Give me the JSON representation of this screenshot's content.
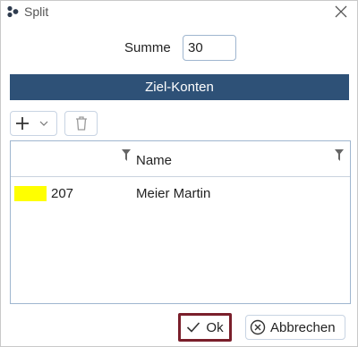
{
  "window": {
    "title": "Split",
    "app_icon": "app-logo-icon",
    "close_icon": "close-icon"
  },
  "summe": {
    "label": "Summe",
    "value": "30"
  },
  "section": {
    "title": "Ziel-Konten"
  },
  "toolbar": {
    "add_icon": "plus-icon",
    "dropdown_icon": "chevron-down-icon",
    "delete_icon": "trash-icon"
  },
  "grid": {
    "columns": [
      {
        "label": "",
        "filter_icon": "filter-icon"
      },
      {
        "label": "Name",
        "filter_icon": "filter-icon"
      }
    ],
    "rows": [
      {
        "color": "#ffff00",
        "number": "207",
        "name": "Meier Martin"
      }
    ]
  },
  "buttons": {
    "ok_label": "Ok",
    "ok_icon": "checkmark-icon",
    "cancel_label": "Abbrechen",
    "cancel_icon": "cancel-circle-icon"
  },
  "colors": {
    "header_bg": "#2e5177",
    "ok_border": "#7a1f2b",
    "row_swatch": "#ffff00"
  }
}
